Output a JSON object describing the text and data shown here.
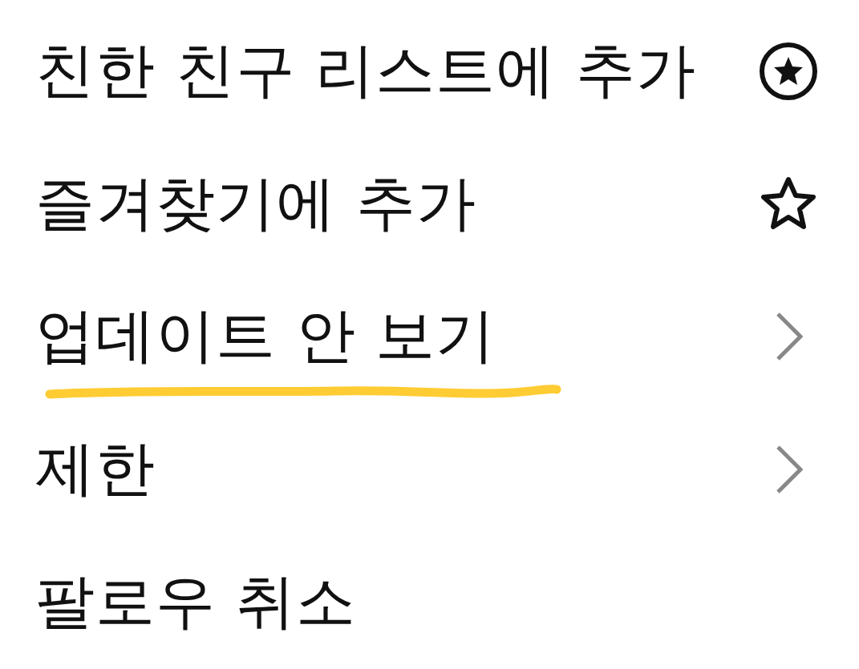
{
  "menu": [
    {
      "label": "친한 친구 리스트에 추가",
      "kind": "star-badge",
      "highlighted": false
    },
    {
      "label": "즐겨찾기에 추가",
      "kind": "star",
      "highlighted": false
    },
    {
      "label": "업데이트 안 보기",
      "kind": "chevron",
      "highlighted": true
    },
    {
      "label": "제한",
      "kind": "chevron",
      "highlighted": false
    },
    {
      "label": "팔로우 취소",
      "kind": "none",
      "highlighted": false
    }
  ]
}
